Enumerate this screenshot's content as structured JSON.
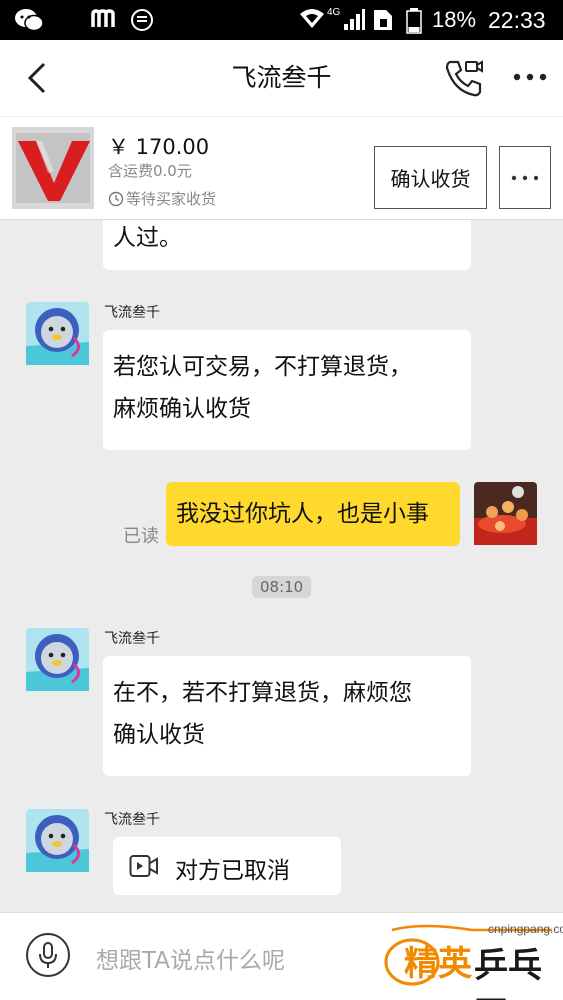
{
  "status_bar": {
    "battery_percent": "18%",
    "time": "22:33",
    "network": "4G"
  },
  "header": {
    "title": "飞流叁千",
    "back_icon": "chevron-left-icon",
    "video_call_icon": "phone-video-icon",
    "more_icon": "ellipsis-icon"
  },
  "product": {
    "price": "￥ 170.00",
    "shipping": "含运费0.0元",
    "status": "等待买家收货",
    "confirm_label": "确认收货",
    "more_label": "···"
  },
  "chat": {
    "partial_text": "人过。",
    "messages": [
      {
        "sender": "飞流叁千",
        "lines": [
          "若您认可交易，不打算退货，",
          "麻烦确认收货"
        ]
      },
      {
        "mine": true,
        "text": "我没过你坑人，也是小事",
        "read_label": "已读"
      },
      {
        "timestamp": "08:10"
      },
      {
        "sender": "飞流叁千",
        "lines": [
          "在不，若不打算退货，麻烦您",
          "确认收货"
        ]
      },
      {
        "sender": "飞流叁千",
        "call_text": "对方已取消"
      }
    ]
  },
  "input": {
    "placeholder": "想跟TA说点什么呢"
  },
  "watermark": {
    "url": "cnpingpang.com",
    "brand": "精英",
    "brand2": "乒乓网"
  },
  "colors": {
    "my_bubble": "#ffd92e",
    "chat_bg": "#ececec",
    "watermark_orange": "#f08a00"
  }
}
